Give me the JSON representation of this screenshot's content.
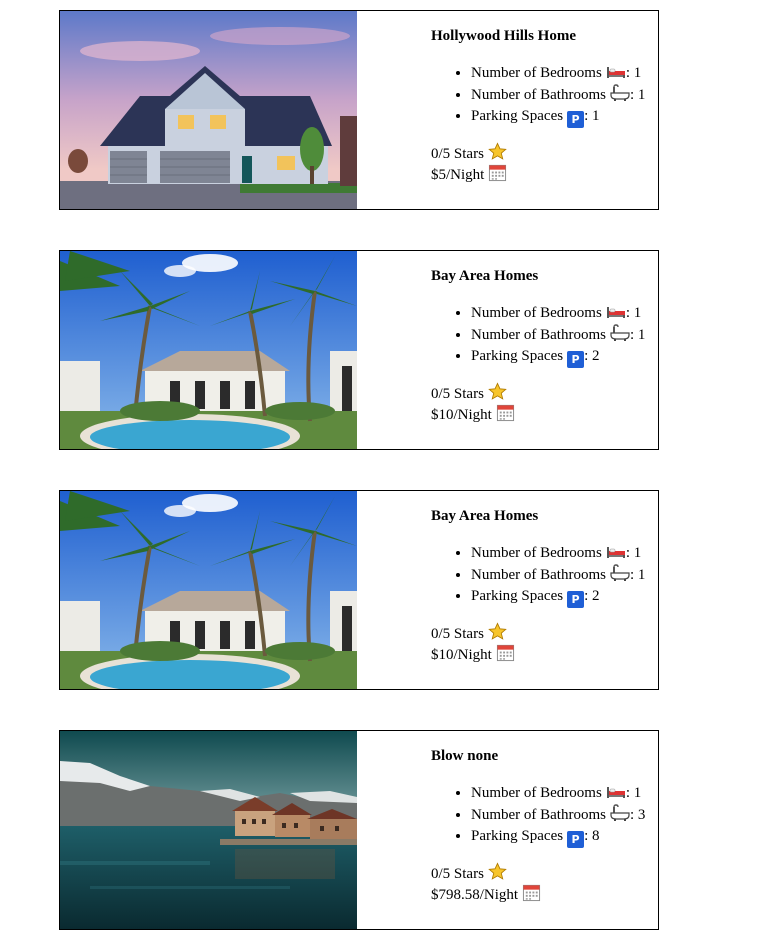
{
  "labels": {
    "bedrooms": "Number of Bedrooms",
    "bathrooms": "Number of Bathrooms",
    "parking": "Parking Spaces",
    "parking_icon_letter": "P",
    "sep": ": "
  },
  "icons": {
    "bed": "bed-icon",
    "bath": "bathtub-icon",
    "parking": "parking-icon",
    "star": "star-icon",
    "calendar": "calendar-icon"
  },
  "listings": [
    {
      "photo": "suburban-house-photo",
      "title": "Hollywood Hills Home",
      "bedrooms": "1",
      "bathrooms": "1",
      "parking": "1",
      "rating": "0/5 Stars",
      "price": "$5/Night"
    },
    {
      "photo": "palm-villa-pool-photo",
      "title": "Bay Area Homes",
      "bedrooms": "1",
      "bathrooms": "1",
      "parking": "2",
      "rating": "0/5 Stars",
      "price": "$10/Night"
    },
    {
      "photo": "palm-villa-pool-photo",
      "title": "Bay Area Homes",
      "bedrooms": "1",
      "bathrooms": "1",
      "parking": "2",
      "rating": "0/5 Stars",
      "price": "$10/Night"
    },
    {
      "photo": "lake-mountain-village-photo",
      "title": "Blow none",
      "bedrooms": "1",
      "bathrooms": "3",
      "parking": "8",
      "rating": "0/5 Stars",
      "price": "$798.58/Night"
    }
  ]
}
